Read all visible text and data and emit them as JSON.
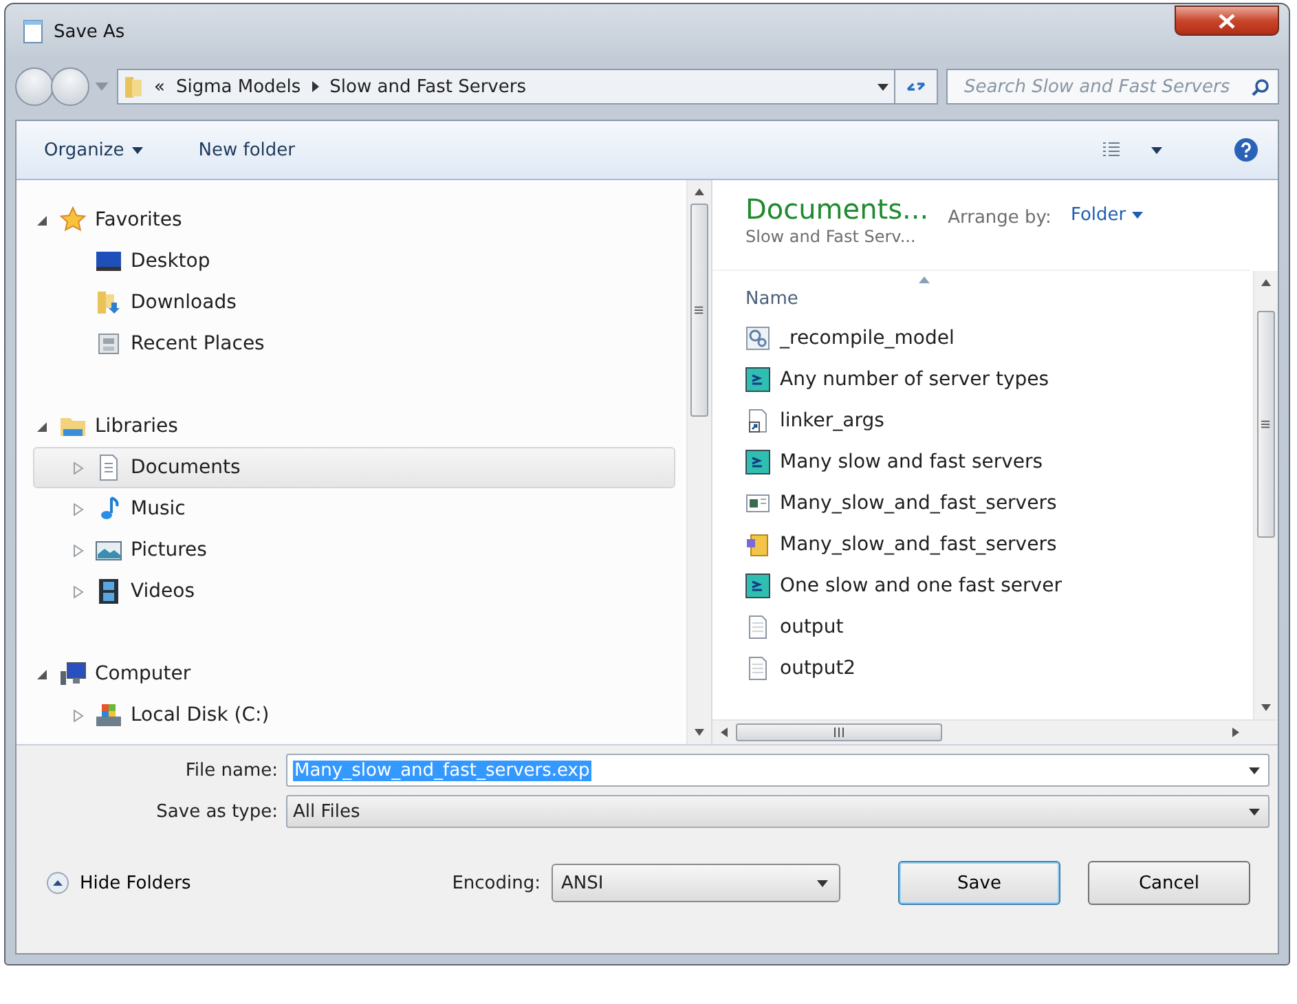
{
  "window": {
    "title": "Save As"
  },
  "address": {
    "overflow": "«",
    "crumbs": [
      "Sigma Models",
      "Slow and Fast Servers"
    ]
  },
  "search": {
    "placeholder": "Search Slow and Fast Servers"
  },
  "toolbar": {
    "organize": "Organize",
    "new_folder": "New folder"
  },
  "nav": [
    {
      "label": "Favorites",
      "kind": "star",
      "expanded": true,
      "children": [
        {
          "label": "Desktop",
          "kind": "desktop",
          "selected": false
        },
        {
          "label": "Downloads",
          "kind": "downloads",
          "selected": false
        },
        {
          "label": "Recent Places",
          "kind": "recent",
          "selected": false
        }
      ]
    },
    {
      "label": "Libraries",
      "kind": "library",
      "expanded": true,
      "children": [
        {
          "label": "Documents",
          "kind": "documents",
          "expanded": false,
          "selected": true
        },
        {
          "label": "Music",
          "kind": "music",
          "expanded": false,
          "selected": false
        },
        {
          "label": "Pictures",
          "kind": "pictures",
          "expanded": false,
          "selected": false
        },
        {
          "label": "Videos",
          "kind": "videos",
          "expanded": false,
          "selected": false
        }
      ]
    },
    {
      "label": "Computer",
      "kind": "computer",
      "expanded": true,
      "children": [
        {
          "label": "Local Disk (C:)",
          "kind": "disk",
          "expanded": false,
          "selected": false
        }
      ]
    }
  ],
  "library": {
    "title": "Documents...",
    "subtitle": "Slow and Fast Serv...",
    "arrange_label": "Arrange by:",
    "arrange_value": "Folder"
  },
  "columns": [
    "Name"
  ],
  "files": [
    {
      "name": "_recompile_model",
      "kind": "script"
    },
    {
      "name": "Any number of server types",
      "kind": "model"
    },
    {
      "name": "linker_args",
      "kind": "shortcut"
    },
    {
      "name": "Many slow and fast servers",
      "kind": "model"
    },
    {
      "name": "Many_slow_and_fast_servers",
      "kind": "window"
    },
    {
      "name": "Many_slow_and_fast_servers",
      "kind": "package"
    },
    {
      "name": "One slow and one fast server",
      "kind": "model"
    },
    {
      "name": "output",
      "kind": "text"
    },
    {
      "name": "output2",
      "kind": "text"
    }
  ],
  "file_name": {
    "label": "File name:",
    "value": "Many_slow_and_fast_servers.exp"
  },
  "save_type": {
    "label": "Save as type:",
    "value": "All Files"
  },
  "hide_folders": "Hide Folders",
  "encoding": {
    "label": "Encoding:",
    "value": "ANSI"
  },
  "buttons": [
    "Save",
    "Cancel"
  ]
}
